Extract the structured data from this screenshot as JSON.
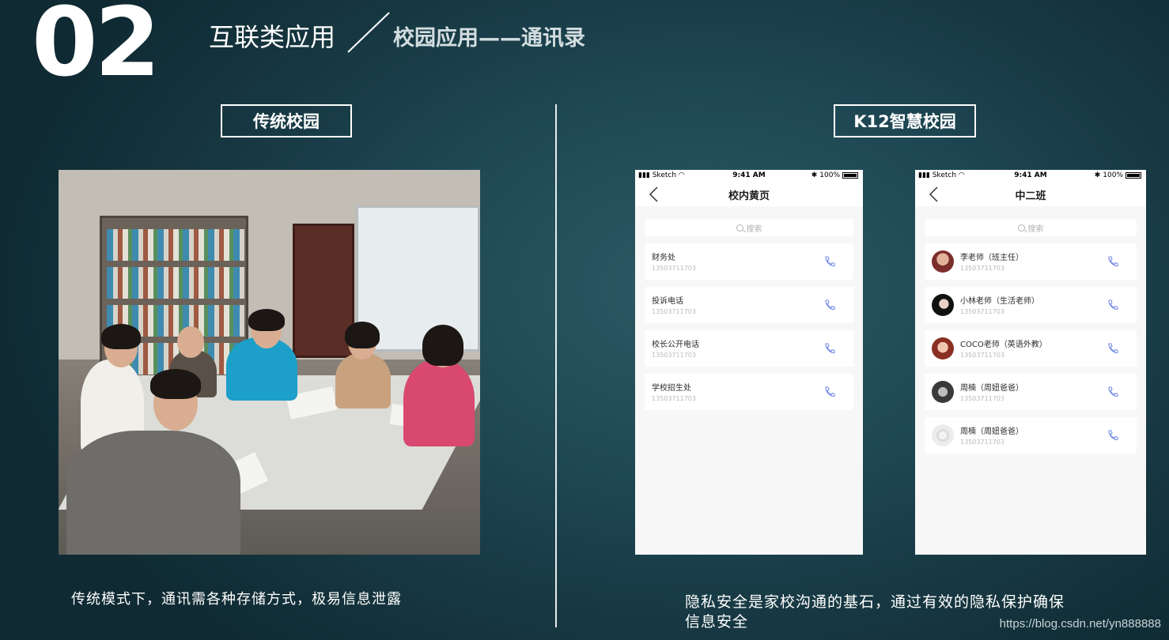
{
  "header": {
    "slide_number": "02",
    "title": "互联类应用",
    "subtitle": "校园应用——通讯录"
  },
  "sections": {
    "left_label": "传统校园",
    "right_label": "K12智慧校园"
  },
  "phone_left": {
    "status": {
      "signal": "Sketch",
      "time": "9:41 AM",
      "battery": "100%"
    },
    "title": "校内黄页",
    "search_placeholder": "搜索",
    "contacts": [
      {
        "name": "财务处",
        "phone": "13503711703"
      },
      {
        "name": "投诉电话",
        "phone": "13503711703"
      },
      {
        "name": "校长公开电话",
        "phone": "13503711703"
      },
      {
        "name": "学校招生处",
        "phone": "13503711703"
      }
    ]
  },
  "phone_right": {
    "status": {
      "signal": "Sketch",
      "time": "9:41 AM",
      "battery": "100%"
    },
    "title": "中二班",
    "search_placeholder": "搜索",
    "contacts": [
      {
        "name": "李老师（班主任）",
        "phone": "13503711703",
        "avatar": "woman-avatar-1"
      },
      {
        "name": "小林老师（生活老师）",
        "phone": "13503711703",
        "avatar": "woman-avatar-2"
      },
      {
        "name": "COCO老师（英语外教）",
        "phone": "13503711703",
        "avatar": "woman-avatar-3"
      },
      {
        "name": "周楠（周妞爸爸）",
        "phone": "13503711703",
        "avatar": "man-avatar"
      },
      {
        "name": "周楠（周妞爸爸）",
        "phone": "13503711703",
        "avatar": "placeholder-avatar"
      }
    ]
  },
  "captions": {
    "left": "传统模式下，通讯需各种存储方式，极易信息泄露",
    "right_line1": "隐私安全是家校沟通的基石，通过有效的隐私保护确保",
    "right_line2": "信息安全"
  },
  "watermark": "https://blog.csdn.net/yn888888",
  "colors": {
    "background": "#1d4652",
    "accent_icon": "#7a8ee6",
    "text_light": "#ffffff",
    "subtitle": "#d3dde0"
  }
}
